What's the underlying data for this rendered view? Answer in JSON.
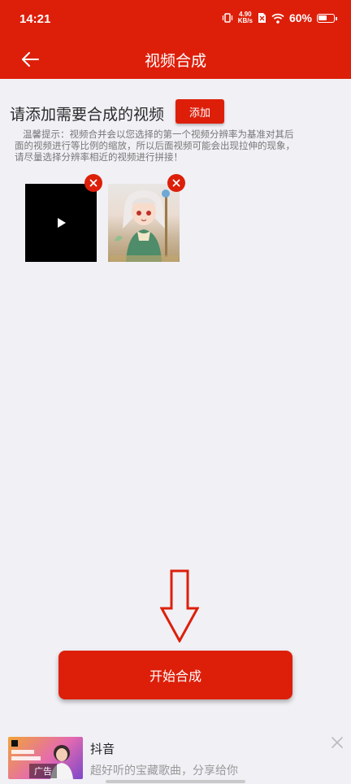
{
  "status_bar": {
    "time": "14:21",
    "net_speed_value": "4.90",
    "net_speed_unit": "KB/s",
    "battery": "60%"
  },
  "app_bar": {
    "title": "视频合成"
  },
  "content": {
    "heading": "请添加需要合成的视频",
    "add_button": "添加",
    "tip": "温馨提示：视频合并会以您选择的第一个视频分辨率为基准对其后面的视频进行等比例的缩放，所以后面视频可能会出现拉伸的现象，请尽量选择分辨率相近的视频进行拼接！",
    "start_button": "开始合成"
  },
  "ad": {
    "label": "广告",
    "title": "抖音",
    "subtitle": "超好听的宝藏歌曲，分享给你"
  },
  "colors": {
    "primary": "#dd1f0a",
    "background": "#f1f0f5"
  },
  "icons": [
    "back-arrow-icon",
    "play-icon",
    "remove-icon",
    "down-arrow-icon",
    "close-icon",
    "wifi-icon",
    "battery-icon"
  ]
}
